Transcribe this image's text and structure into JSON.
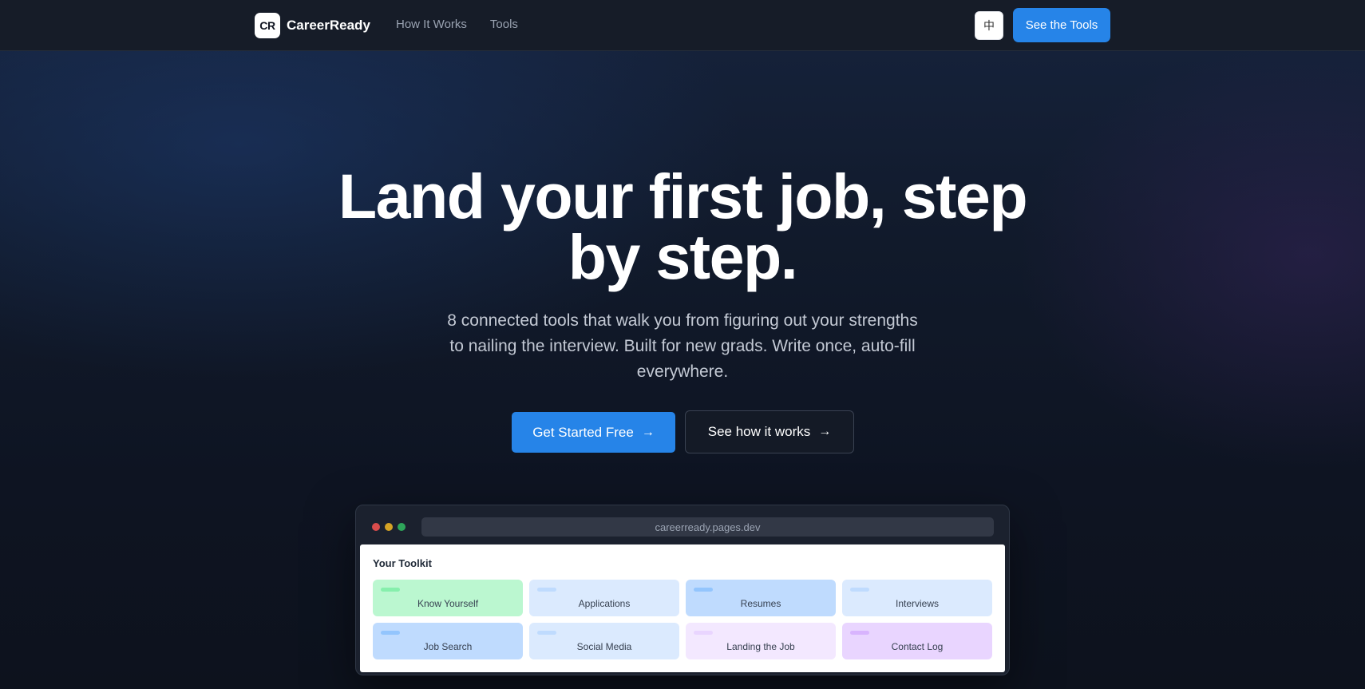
{
  "nav": {
    "logo_mark": "CR",
    "brand": "CareerReady",
    "links": [
      "How It Works",
      "Tools"
    ],
    "lang_toggle": "中",
    "cta": "See the Tools"
  },
  "hero": {
    "title_line1": "Land your first job, step",
    "title_line2": "by step.",
    "subtitle": "8 connected tools that walk you from figuring out your strengths to nailing the interview. Built for new grads. Write once, auto-fill everywhere.",
    "primary_button": "Get Started Free",
    "secondary_button": "See how it works",
    "arrow": "→"
  },
  "preview": {
    "url": "careerready.pages.dev",
    "toolkit_title": "Your Toolkit",
    "cards": [
      {
        "label": "Know Yourself",
        "bg": "#bbf7d0",
        "bar": "#86efac"
      },
      {
        "label": "Applications",
        "bg": "#dbeafe",
        "bar": "#bfdbfe"
      },
      {
        "label": "Resumes",
        "bg": "#bfdbfe",
        "bar": "#93c5fd"
      },
      {
        "label": "Interviews",
        "bg": "#dbeafe",
        "bar": "#bfdbfe"
      },
      {
        "label": "Job Search",
        "bg": "#bfdbfe",
        "bar": "#93c5fd"
      },
      {
        "label": "Social Media",
        "bg": "#dbeafe",
        "bar": "#bfdbfe"
      },
      {
        "label": "Landing the Job",
        "bg": "#f3e8ff",
        "bar": "#e9d5ff"
      },
      {
        "label": "Contact Log",
        "bg": "#e9d5ff",
        "bar": "#d8b4fe"
      }
    ]
  },
  "colors": {
    "accent": "#2684e8",
    "background": "#0f1420"
  }
}
